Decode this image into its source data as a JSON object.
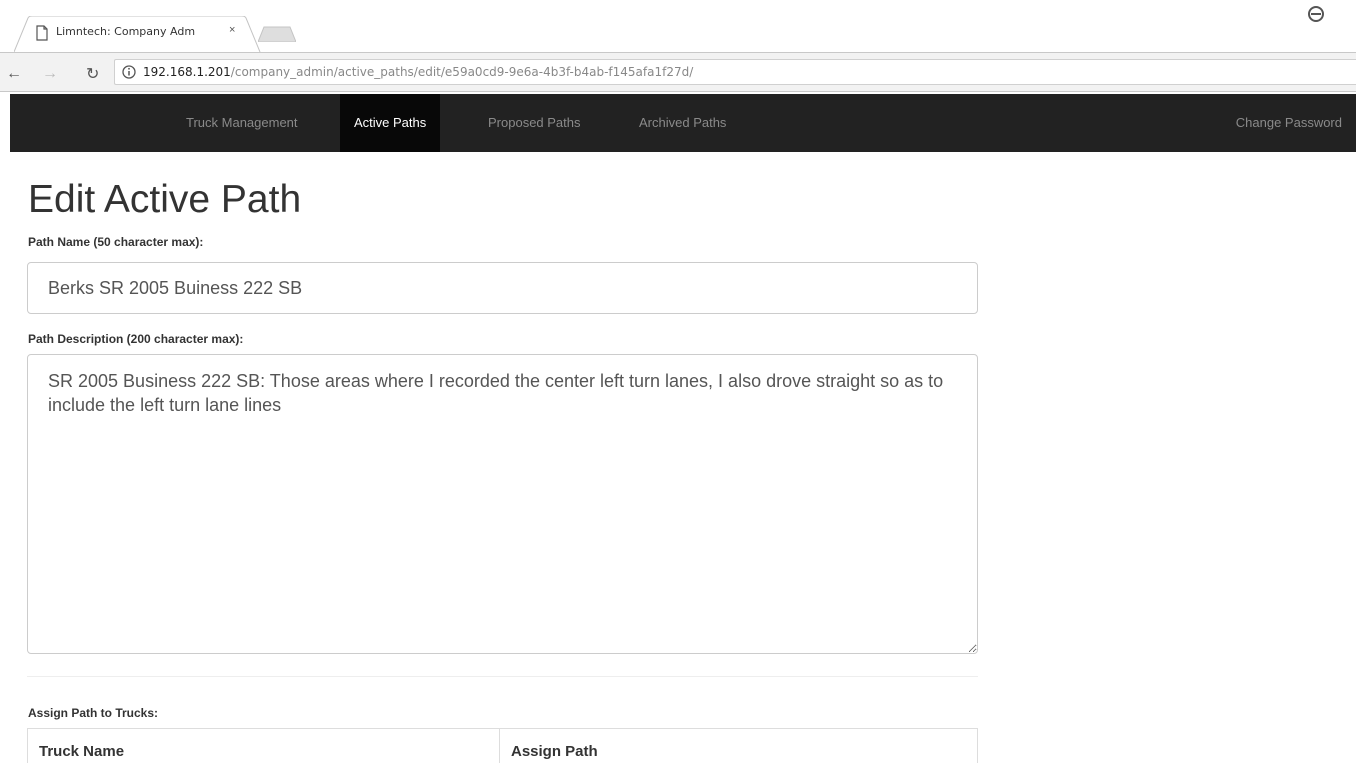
{
  "browser": {
    "tab_title": "Limntech: Company Adm",
    "tab_close": "×",
    "url_host": "192.168.1.201",
    "url_path": "/company_admin/active_paths/edit/e59a0cd9-9e6a-4b3f-b4ab-f145afa1f27d/",
    "icons": [
      "document-icon",
      "close-icon",
      "new-tab-icon",
      "profile-icon",
      "back-icon",
      "forward-icon",
      "reload-icon",
      "info-icon"
    ]
  },
  "navbar": {
    "items": [
      {
        "label": "Truck Management",
        "active": false
      },
      {
        "label": "Active Paths",
        "active": true
      },
      {
        "label": "Proposed Paths",
        "active": false
      },
      {
        "label": "Archived Paths",
        "active": false
      }
    ],
    "right_item": "Change Password"
  },
  "form": {
    "title": "Edit Active Path",
    "name_label": "Path Name (50 character max):",
    "name_value": "Berks SR 2005 Buiness 222 SB",
    "description_label": "Path Description (200 character max):",
    "description_value": "SR 2005 Business 222 SB: Those areas where I recorded the center left turn lanes, I also drove straight so as to include the left turn lane lines",
    "assign_label": "Assign Path to Trucks:",
    "table_headers": [
      "Truck Name",
      "Assign Path"
    ]
  },
  "colors": {
    "navbar_bg": "#222222",
    "navbar_active_bg": "#080808",
    "navbar_text": "#8a8a8a",
    "navbar_active_text": "#ffffff"
  }
}
